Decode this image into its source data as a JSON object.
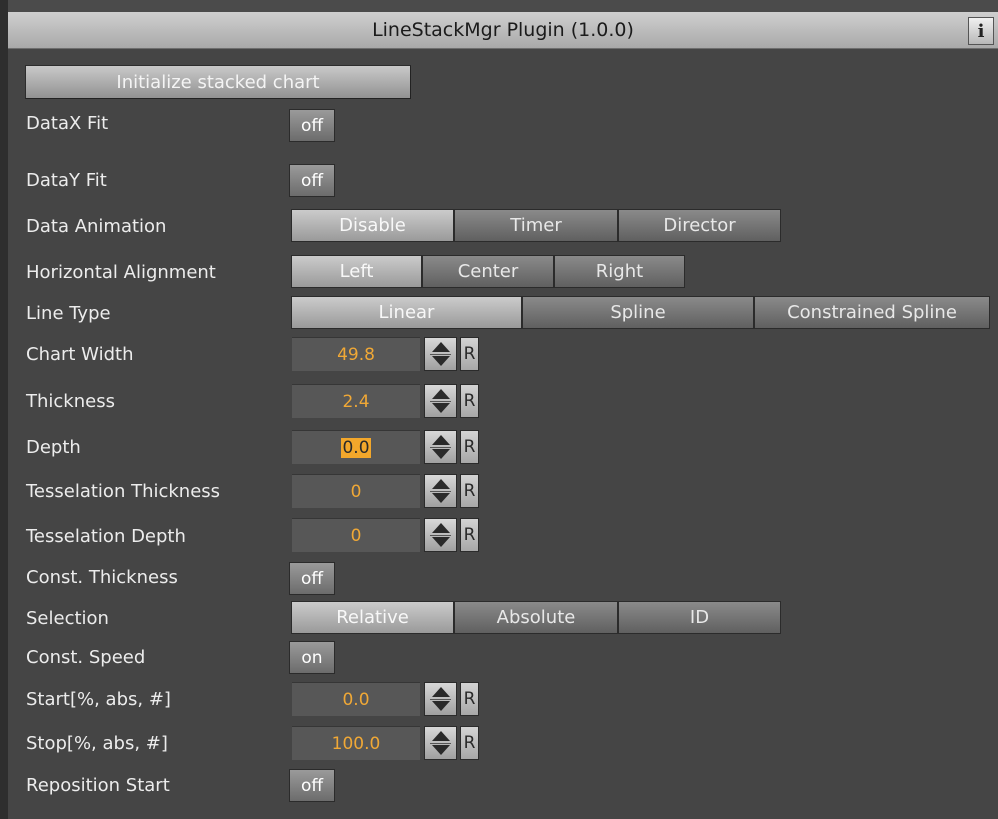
{
  "window": {
    "title": "LineStackMgr Plugin (1.0.0)",
    "info_label": "i"
  },
  "init_button_label": "Initialize stacked chart",
  "rows": {
    "datax_fit": {
      "label": "DataX Fit",
      "value": "off"
    },
    "datay_fit": {
      "label": "DataY Fit",
      "value": "off"
    },
    "data_animation": {
      "label": "Data Animation",
      "options": [
        "Disable",
        "Timer",
        "Director"
      ],
      "selected": "Disable"
    },
    "horizontal_alignment": {
      "label": "Horizontal Alignment",
      "options": [
        "Left",
        "Center",
        "Right"
      ],
      "selected": "Left"
    },
    "line_type": {
      "label": "Line Type",
      "options": [
        "Linear",
        "Spline",
        "Constrained Spline"
      ],
      "selected": "Linear"
    },
    "chart_width": {
      "label": "Chart Width",
      "value": "49.8"
    },
    "thickness": {
      "label": "Thickness",
      "value": "2.4"
    },
    "depth": {
      "label": "Depth",
      "value": "0.0"
    },
    "tesselation_thickness": {
      "label": "Tesselation Thickness",
      "value": "0"
    },
    "tesselation_depth": {
      "label": "Tesselation Depth",
      "value": "0"
    },
    "const_thickness": {
      "label": "Const. Thickness",
      "value": "off"
    },
    "selection": {
      "label": "Selection",
      "options": [
        "Relative",
        "Absolute",
        "ID"
      ],
      "selected": "Relative"
    },
    "const_speed": {
      "label": "Const. Speed",
      "value": "on"
    },
    "start": {
      "label": "Start[%, abs, #]",
      "value": "0.0"
    },
    "stop": {
      "label": "Stop[%, abs, #]",
      "value": "100.0"
    },
    "reposition_start": {
      "label": "Reposition Start",
      "value": "off"
    }
  },
  "reset_label": "R"
}
